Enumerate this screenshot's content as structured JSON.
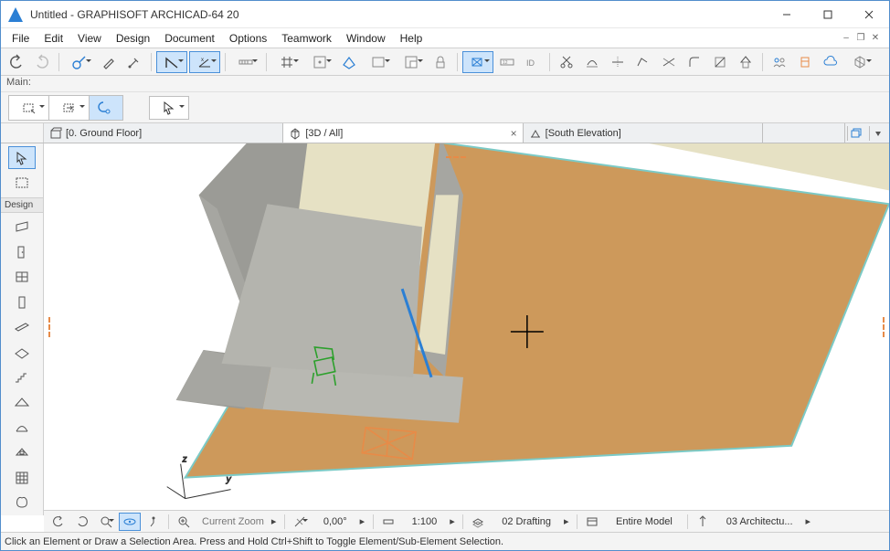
{
  "title": "Untitled - GRAPHISOFT ARCHICAD-64 20",
  "menu": [
    "File",
    "Edit",
    "View",
    "Design",
    "Document",
    "Options",
    "Teamwork",
    "Window",
    "Help"
  ],
  "main_label": "Main:",
  "tabs": [
    {
      "label": "[0. Ground Floor]",
      "active": false,
      "closable": false
    },
    {
      "label": "[3D / All]",
      "active": true,
      "closable": true
    },
    {
      "label": "[South Elevation]",
      "active": false,
      "closable": false
    }
  ],
  "toolbox_section": "Design",
  "bottom": {
    "zoom_label": "Current Zoom",
    "angle": "0,00°",
    "scale": "1:100",
    "layer": "02 Drafting",
    "model": "Entire Model",
    "unit": "03 Architectu..."
  },
  "status": "Click an Element or Draw a Selection Area. Press and Hold Ctrl+Shift to Toggle Element/Sub-Element Selection."
}
